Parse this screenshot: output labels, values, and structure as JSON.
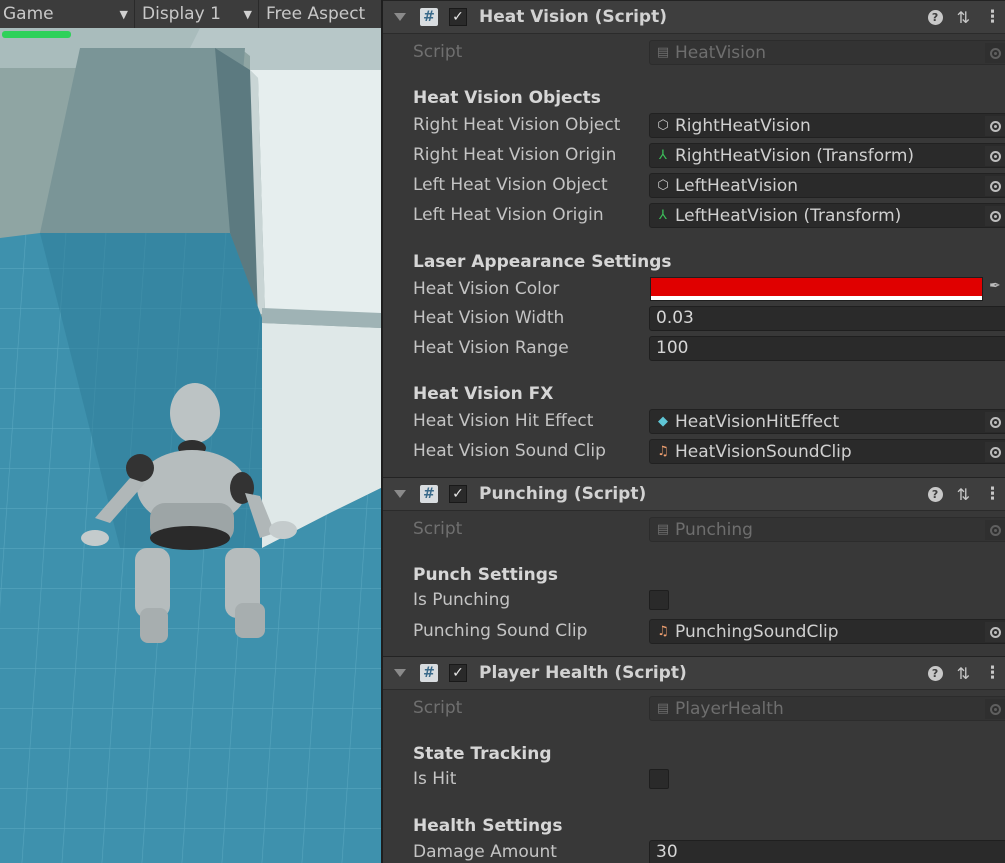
{
  "game_view": {
    "tab_label": "Game",
    "display_label": "Display 1",
    "aspect_label": "Free Aspect",
    "load_progress": 0.18
  },
  "components": [
    {
      "title": "Heat Vision (Script)",
      "script_label": "Script",
      "script_value": "HeatVision",
      "sections": [
        {
          "title": "Heat Vision Objects",
          "fields": [
            {
              "label": "Right Heat Vision Object",
              "value": "RightHeatVision",
              "icon": "gameobject-icon"
            },
            {
              "label": "Right Heat Vision Origin",
              "value": "RightHeatVision (Transform)",
              "icon": "transform-icon"
            },
            {
              "label": "Left Heat Vision Object",
              "value": "LeftHeatVision",
              "icon": "gameobject-icon"
            },
            {
              "label": "Left Heat Vision Origin",
              "value": "LeftHeatVision (Transform)",
              "icon": "transform-icon"
            }
          ]
        },
        {
          "title": "Laser Appearance Settings",
          "fields": [
            {
              "label": "Heat Vision Color",
              "color": "#e00000"
            },
            {
              "label": "Heat Vision Width",
              "value": "0.03"
            },
            {
              "label": "Heat Vision Range",
              "value": "100"
            }
          ]
        },
        {
          "title": "Heat Vision FX",
          "fields": [
            {
              "label": "Heat Vision Hit Effect",
              "value": "HeatVisionHitEffect",
              "icon": "prefab-icon"
            },
            {
              "label": "Heat Vision Sound Clip",
              "value": "HeatVisionSoundClip",
              "icon": "audioclip-icon"
            }
          ]
        }
      ]
    },
    {
      "title": "Punching (Script)",
      "script_label": "Script",
      "script_value": "Punching",
      "sections": [
        {
          "title": "Punch Settings",
          "fields": [
            {
              "label": "Is Punching",
              "checked": false
            },
            {
              "label": "Punching Sound Clip",
              "value": "PunchingSoundClip",
              "icon": "audioclip-icon"
            }
          ]
        }
      ]
    },
    {
      "title": "Player Health (Script)",
      "script_label": "Script",
      "script_value": "PlayerHealth",
      "sections": [
        {
          "title": "State Tracking",
          "fields": [
            {
              "label": "Is Hit",
              "checked": false
            }
          ]
        },
        {
          "title": "Health Settings",
          "fields": [
            {
              "label": "Damage Amount",
              "value": "30"
            }
          ]
        }
      ]
    }
  ],
  "colors": {
    "inspector_bg": "#383838",
    "header_bg": "#3e3e3e",
    "field_bg": "#2a2a2a",
    "heat_vision_color": "#e00000",
    "load_bar": "#2fd15a"
  }
}
